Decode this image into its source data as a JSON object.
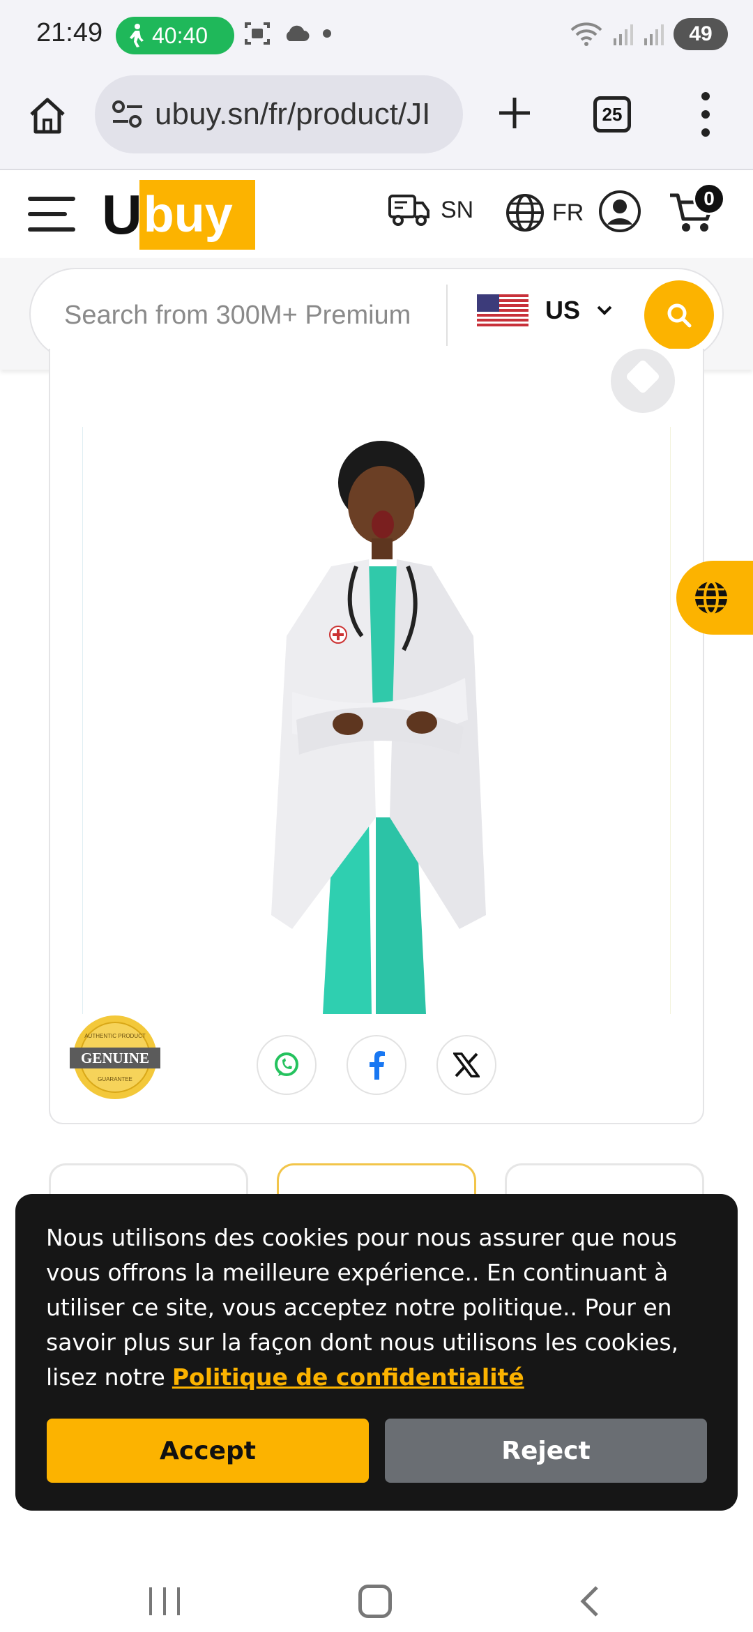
{
  "status_bar": {
    "time": "21:49",
    "call_timer": "40:40",
    "battery": "49"
  },
  "browser": {
    "url": "ubuy.sn/fr/product/JI",
    "tab_count": "25"
  },
  "header": {
    "logo_u": "U",
    "logo_buy": "buy",
    "ship_to": "SN",
    "language": "FR",
    "cart_count": "0"
  },
  "search": {
    "placeholder": "Search from 300M+ Premium",
    "country": "US"
  },
  "product": {
    "badge_text": "GENUINE",
    "badge_top": "AUTHENTIC PRODUCT",
    "badge_bottom": "GUARANTEE"
  },
  "cookie": {
    "message": "Nous utilisons des cookies pour nous assurer que nous vous offrons la meilleure expérience.. En continuant à utiliser ce site, vous acceptez notre politique.. Pour en savoir plus sur la façon dont nous utilisons les cookies, lisez notre",
    "link_text": "Politique de confidentialité",
    "accept_label": "Accept",
    "reject_label": "Reject"
  },
  "colors": {
    "brand_yellow": "#fcb300",
    "call_green": "#1fb85a",
    "banner_bg": "#161616",
    "reject_gray": "#6a6e73"
  }
}
